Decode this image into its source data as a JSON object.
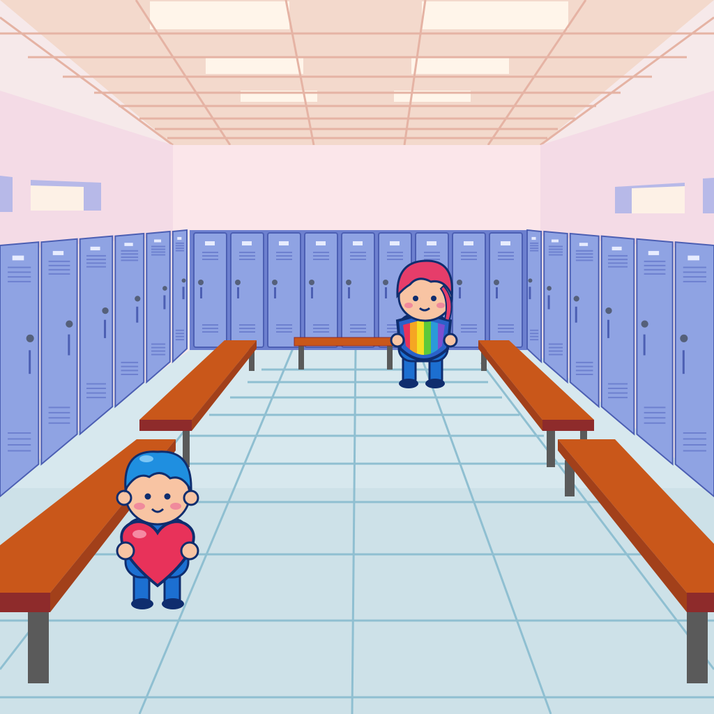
{
  "scene": {
    "description": "",
    "palette": {
      "ceiling": "#f3d9cc",
      "ceiling_grid": "#e5b3a4",
      "ceiling_light": "#fff5ea",
      "wall": "#fbe6ea",
      "wall_side": "#f4dbe6",
      "locker": "#8fa3e3",
      "locker_dark": "#6d80cf",
      "locker_outline": "#4c5fb3",
      "floor": "#cde1e8",
      "floor_line": "#8fbfd1",
      "bench_top": "#c9571a",
      "bench_edge": "#8e2b2b",
      "bench_leg": "#5a5a5a",
      "child_hair_blue": "#1f8fe0",
      "child_hair_red": "#e63d6a",
      "heart": "#e8325a",
      "shirt_blue": "#1c6fd1"
    }
  },
  "characters": [
    {
      "name": "child-with-heart",
      "holding": "heart-icon"
    },
    {
      "name": "child-with-shield",
      "holding": "rainbow-shield-icon"
    }
  ]
}
